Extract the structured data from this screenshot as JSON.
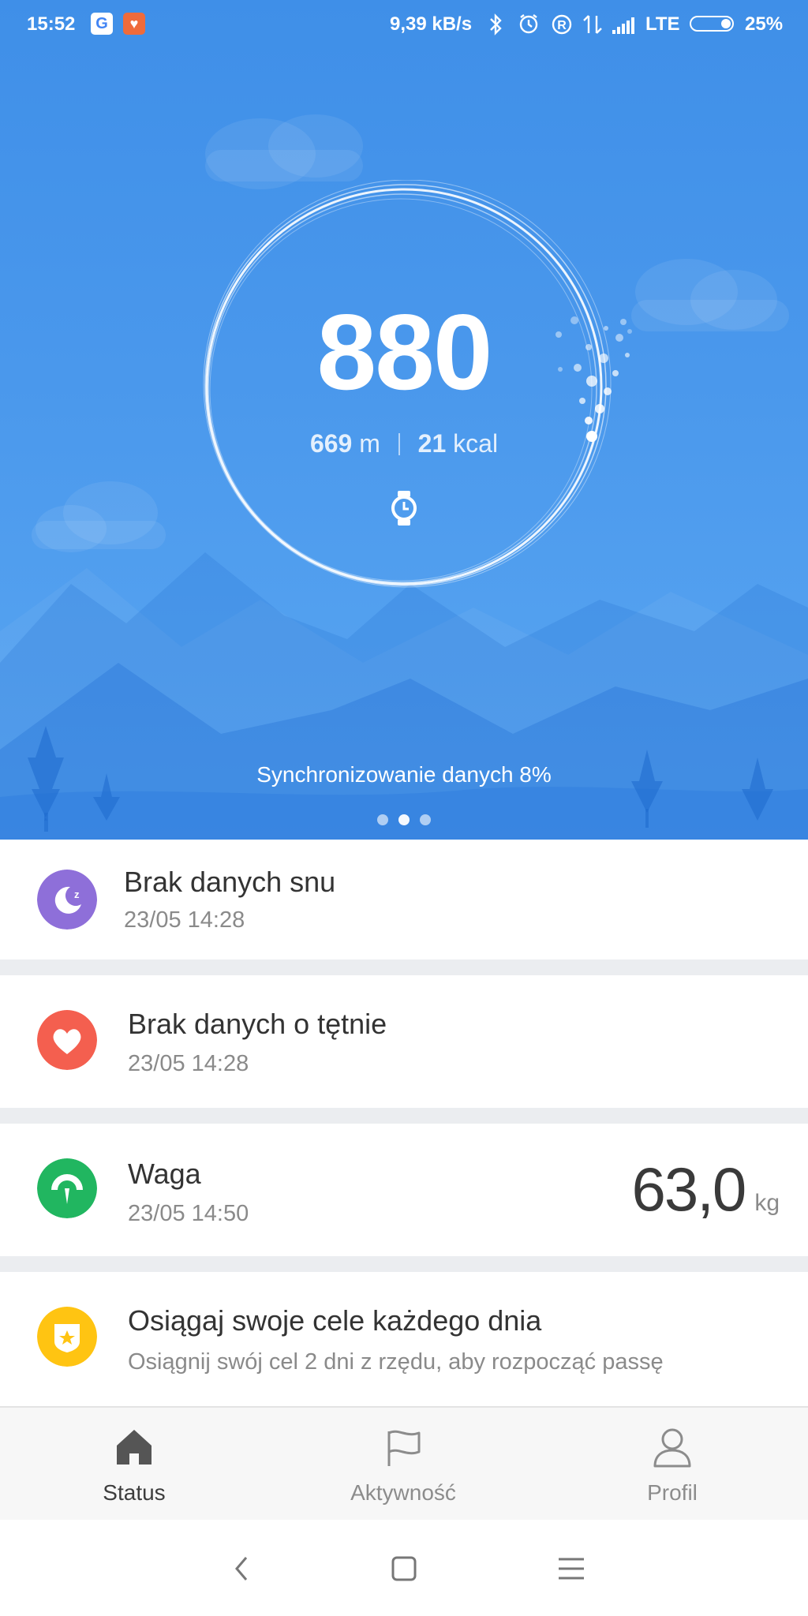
{
  "status_bar": {
    "time": "15:52",
    "app_icons": [
      "google-app-icon",
      "heart-app-icon"
    ],
    "network_speed": "9,39 kB/s",
    "network_type": "LTE",
    "battery_percent": "25%",
    "battery_level": 0.25
  },
  "hero": {
    "steps": "880",
    "distance_value": "669",
    "distance_unit": "m",
    "calories_value": "21",
    "calories_unit": "kcal",
    "sync_text": "Synchronizowanie danych 8%",
    "page_count": 3,
    "active_page": 1
  },
  "cards": {
    "sleep": {
      "title": "Brak danych snu",
      "date": "23/05 14:28",
      "color": "#8e6fd9"
    },
    "heart": {
      "title": "Brak danych o tętnie",
      "date": "23/05 14:28",
      "color": "#f45f4f"
    },
    "weight": {
      "title": "Waga",
      "date": "23/05 14:50",
      "value": "63,0",
      "unit": "kg",
      "color": "#21b660"
    },
    "goal": {
      "title": "Osiągaj swoje cele każdego dnia",
      "subtitle": "Osiągnij swój cel 2 dni z rzędu, aby rozpocząć passę",
      "color": "#ffc412"
    }
  },
  "nav": {
    "status": "Status",
    "activity": "Aktywność",
    "profile": "Profil",
    "active": "status"
  },
  "colors": {
    "hero_top": "#3f8fe8",
    "hero_bottom": "#5aa7f2",
    "divider": "#ebedf0",
    "nav_active": "#3d3d3d",
    "nav_inactive": "#8c8c8c"
  }
}
